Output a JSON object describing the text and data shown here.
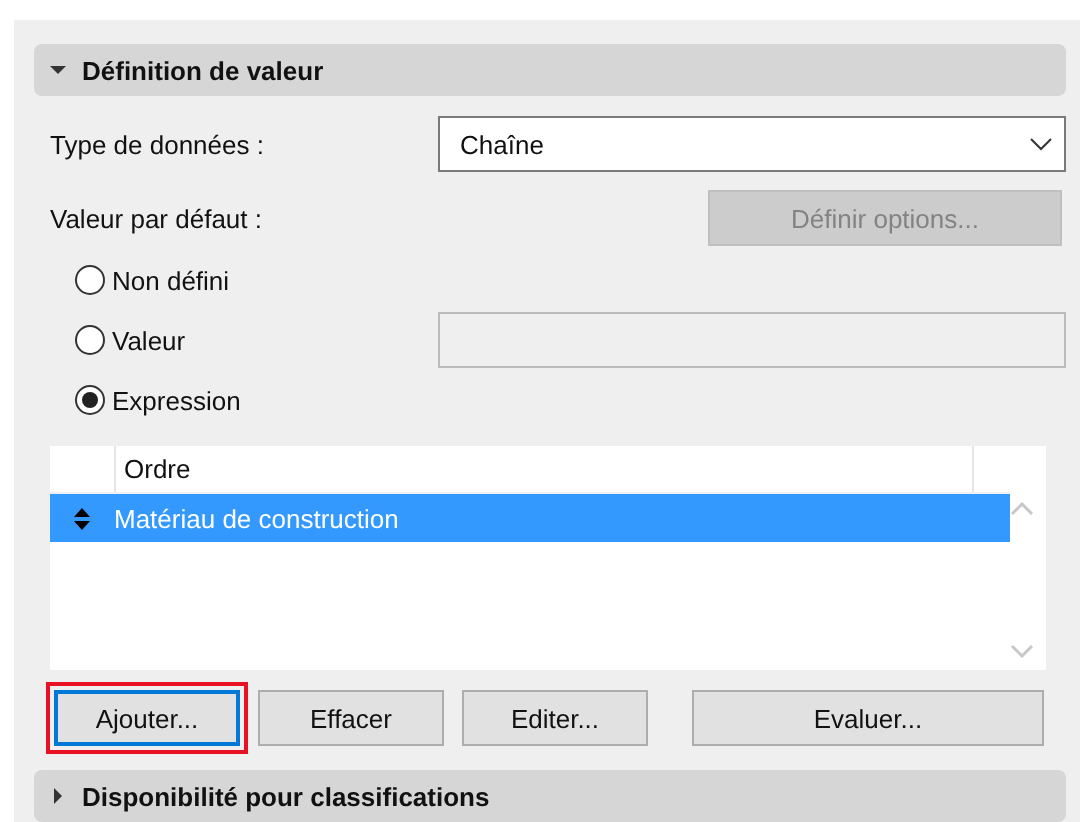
{
  "sections": [
    {
      "title": "Définition de valeur",
      "expanded": true
    },
    {
      "title": "Disponibilité pour classifications",
      "expanded": false
    }
  ],
  "data_type": {
    "label": "Type de données :",
    "value": "Chaîne"
  },
  "default_value": {
    "label": "Valeur par défaut :",
    "options_button": {
      "label": "Définir options...",
      "disabled": true
    }
  },
  "radios": [
    {
      "label": "Non défini",
      "selected": false,
      "kind": "plain"
    },
    {
      "label": "Valeur",
      "selected": false,
      "kind": "field"
    },
    {
      "label": "Expression",
      "selected": true,
      "kind": "plain"
    }
  ],
  "list": {
    "columns": [
      "Ordre"
    ],
    "rows": [
      {
        "label": "Matériau de construction",
        "selected": true
      }
    ]
  },
  "buttons": [
    {
      "label": "Ajouter...",
      "highlighted": true
    },
    {
      "label": "Effacer",
      "highlighted": false
    },
    {
      "label": "Editer...",
      "highlighted": false
    },
    {
      "label": "Evaluer...",
      "highlighted": false
    }
  ]
}
